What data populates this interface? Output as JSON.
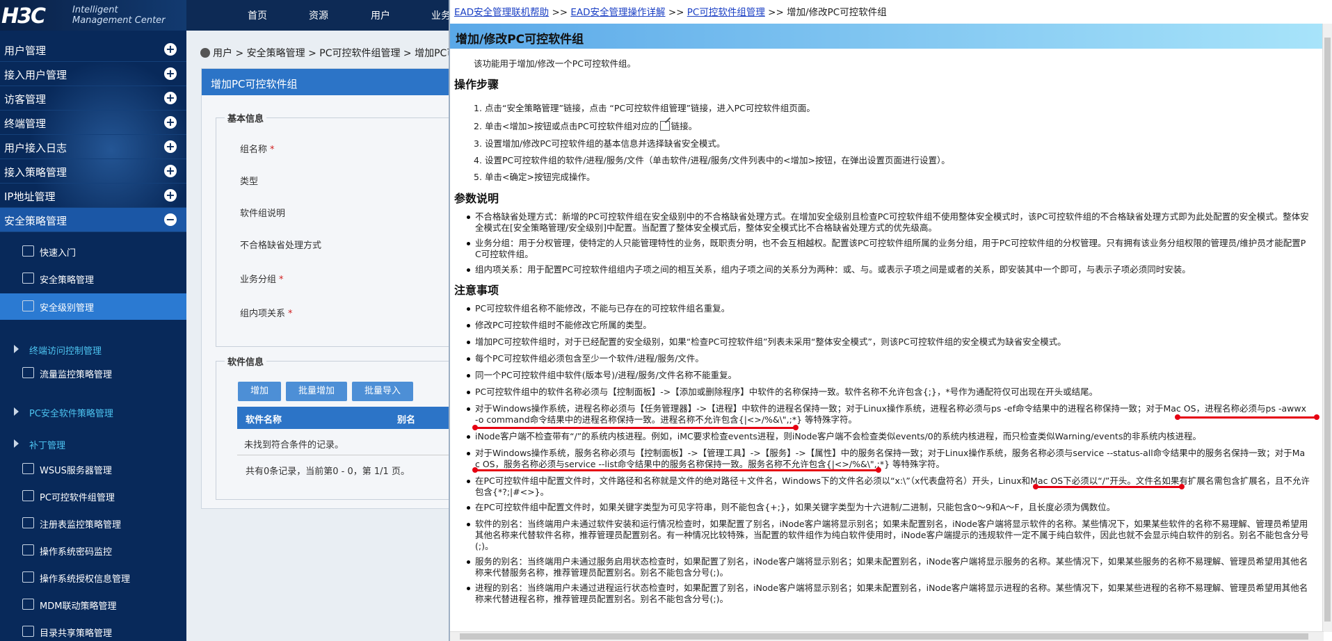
{
  "brand": {
    "logo": "H3C",
    "line1": "Intelligent",
    "line2": "Management Center"
  },
  "topnav": [
    "首页",
    "资源",
    "用户",
    "业务"
  ],
  "sidebar": {
    "top_items": [
      {
        "label": "用户管理",
        "icon": "plus-icon"
      },
      {
        "label": "接入用户管理",
        "icon": "plus-icon"
      },
      {
        "label": "访客管理",
        "icon": "plus-icon"
      },
      {
        "label": "终端管理",
        "icon": "plus-icon"
      },
      {
        "label": "用户接入日志",
        "icon": "plus-icon"
      },
      {
        "label": "接入策略管理",
        "icon": "plus-icon"
      },
      {
        "label": "IP地址管理",
        "icon": "plus-icon"
      },
      {
        "label": "安全策略管理",
        "icon": "minus-icon"
      }
    ],
    "sub_items": [
      {
        "label": "快速入门",
        "icon": "quickstart-icon"
      },
      {
        "label": "安全策略管理",
        "icon": "policy-icon"
      },
      {
        "label": "安全级别管理",
        "icon": "level-icon"
      },
      {
        "label": "终端访问控制管理",
        "icon": "expand-arrow-icon"
      },
      {
        "label": "流量监控策略管理",
        "icon": "monitor-icon"
      },
      {
        "label": "PC安全软件策略管理",
        "icon": "expand-arrow-icon"
      },
      {
        "label": "补丁管理",
        "icon": "expand-arrow-icon"
      },
      {
        "label": "WSUS服务器管理",
        "icon": "server-icon"
      },
      {
        "label": "PC可控软件组管理",
        "icon": "software-group-icon"
      },
      {
        "label": "注册表监控策略管理",
        "icon": "registry-icon"
      },
      {
        "label": "操作系统密码监控",
        "icon": "password-icon"
      },
      {
        "label": "操作系统授权信息管理",
        "icon": "license-icon"
      },
      {
        "label": "MDM联动策略管理",
        "icon": "mdm-icon"
      },
      {
        "label": "目录共享策略管理",
        "icon": "share-icon"
      }
    ]
  },
  "main": {
    "breadcrumb": "用户 > 安全策略管理 > PC可控软件组管理 > 增加PC可控",
    "panel_title": "增加PC可控软件组",
    "basic_legend": "基本信息",
    "fields": [
      "组名称",
      "类型",
      "软件组说明",
      "不合格缺省处理方式",
      "业务分组",
      "组内项关系"
    ],
    "required_mark": "*",
    "software_legend": "软件信息",
    "buttons": [
      "增加",
      "批量增加",
      "批量导入"
    ],
    "table_headers": [
      "软件名称",
      "别名"
    ],
    "empty_text": "未找到符合条件的记录。",
    "pager": "共有0条记录，当前第0 - 0，第 1/1 页。"
  },
  "help": {
    "crumb_links": [
      "EAD安全管理联机帮助",
      "EAD安全管理操作详解",
      "PC可控软件组管理"
    ],
    "crumb_sep": ">>",
    "crumb_current": "增加/修改PC可控软件组",
    "title": "增加/修改PC可控软件组",
    "intro": "该功能用于增加/修改一个PC可控软件组。",
    "steps_heading": "操作步骤",
    "steps": [
      "点击“安全策略管理”链接，点击 “PC可控软件组管理”链接，进入PC可控软件组页面。",
      "单击<增加>按钮或点击PC可控软件组对应的",
      "设置增加/修改PC可控软件组的基本信息并选择缺省安全模式。",
      "设置PC可控软件组的软件/进程/服务/文件（单击软件/进程/服务/文件列表中的<增加>按钮，在弹出设置页面进行设置）。",
      "单击<确定>按钮完成操作。"
    ],
    "step2_suffix": "链接。",
    "params_heading": "参数说明",
    "params": [
      "不合格缺省处理方式：新增的PC可控软件组在安全级别中的不合格缺省处理方式。在增加安全级别且检查PC可控软件组不使用整体安全模式时，该PC可控软件组的不合格缺省处理方式即为此处配置的安全模式。整体安全模式在[安全策略管理/安全级别]中配置。当配置了整体安全模式后，整体安全模式比不合格缺省处理方式的优先级高。",
      "业务分组：用于分权管理，使特定的人只能管理特性的业务，既职责分明，也不会互相越权。配置该PC可控软件组所属的业务分组，用于PC可控软件组的分权管理。只有拥有该业务分组权限的管理员/维护员才能配置PC可控软件组。",
      "组内项关系：用于配置PC可控软件组组内子项之间的相互关系，组内子项之间的关系分为两种：或、与。或表示子项之间是或者的关系，即安装其中一个即可，与表示子项必须同时安装。"
    ],
    "notes_heading": "注意事项",
    "notes": [
      "PC可控软件组名称不能修改，不能与已存在的可控软件组名重复。",
      "修改PC可控软件组时不能修改它所属的类型。",
      "增加PC可控软件组时，对于已经配置的安全级别，如果“检查PC可控软件组”列表未采用“整体安全模式”，则该PC可控软件组的安全模式为缺省安全模式。",
      "每个PC可控软件组必须包含至少一个软件/进程/服务/文件。",
      "同一个PC可控软件组中软件(版本号)/进程/服务/文件名称不能重复。",
      "PC可控软件组中的软件名称必须与【控制面板】->【添加或删除程序】中软件的名称保持一致。软件名称不允许包含{;}，*号作为通配符仅可出现在开头或结尾。",
      "对于Windows操作系统，进程名称必须与【任务管理器】->【进程】中软件的进程名保持一致；对于Linux操作系统，进程名称必须与ps -ef命令结果中的进程名称保持一致；对于Mac OS，进程名称必须与ps -awwx -o command命令结果中的进程名称保持一致。进程名称不允许包含{|<>/%&\\\",;*} 等特殊字符。",
      "iNode客户端不检查带有“/”的系统内核进程。例如，iMC要求检查events进程，则iNode客户端不会检查类似events/0的系统内核进程，而只检查类似Warning/events的非系统内核进程。",
      "对于Windows操作系统，服务名称必须与【控制面板】->【管理工具】->【服务】->【属性】中的服务名保持一致；对于Linux操作系统，服务名称必须与service --status-all命令结果中的服务名保持一致；对于Mac OS，服务名称必须与service --list命令结果中的服务名称保持一致。服务名称不允许包含{|<>/%&\\\",;*} 等特殊字符。",
      "在PC可控软件组中配置文件时，文件路径和名称就是文件的绝对路径＋文件名，Windows下的文件名必须以“x:\\”（x代表盘符名）开头，Linux和Mac OS下必须以“/”开头。文件名如果有扩展名需包含扩展名，且不允许包含{*?;|#<>}。",
      "在PC可控软件组中配置文件时，如果关键字类型为可见字符串，则不能包含{+;}，如果关键字类型为十六进制/二进制，只能包含0～9和A～F，且长度必须为偶数位。",
      "软件的别名：当终端用户未通过软件安装和运行情况检查时，如果配置了别名，iNode客户端将显示别名；如果未配置别名，iNode客户端将显示软件的名称。某些情况下，如果某些软件的名称不易理解、管理员希望用其他名称来代替软件名称，推荐管理员配置别名。有一种情况比较特殊，当配置的软件组作为纯白软件使用时，iNode客户端提示的违规软件一定不属于纯白软件，因此也就不会显示纯白软件的别名。别名不能包含分号(;)。",
      "服务的别名：当终端用户未通过服务启用状态检查时，如果配置了别名，iNode客户端将显示别名；如果未配置别名，iNode客户端将显示服务的名称。某些情况下，如果某些服务的名称不易理解、管理员希望用其他名称来代替服务名称，推荐管理员配置别名。别名不能包含分号(;)。",
      "进程的别名：当终端用户未通过进程运行状态检查时，如果配置了别名，iNode客户端将显示别名；如果未配置别名，iNode客户端将显示进程的名称。某些情况下，如果某些进程的名称不易理解、管理员希望用其他名称来代替进程名称，推荐管理员配置别名。别名不能包含分号(;)。"
    ]
  }
}
